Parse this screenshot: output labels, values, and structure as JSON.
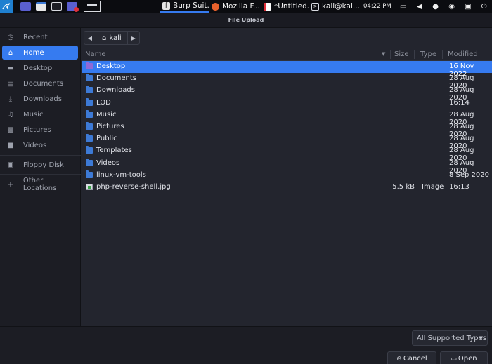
{
  "taskbar": {
    "tasks": [
      {
        "label": "Burp Suit...",
        "icon": "burp-icon"
      },
      {
        "label": "Mozilla F...",
        "icon": "firefox-icon"
      },
      {
        "label": "*Untitled...",
        "icon": "text-editor-icon"
      },
      {
        "label": "kali@kal...",
        "icon": "terminal-icon"
      }
    ],
    "clock": "04:22 PM"
  },
  "dialog": {
    "title": "File Upload"
  },
  "sidebar": {
    "items": [
      {
        "label": "Recent",
        "icon": "clock-icon"
      },
      {
        "label": "Home",
        "icon": "home-icon",
        "selected": true
      },
      {
        "label": "Desktop",
        "icon": "desktop-icon"
      },
      {
        "label": "Documents",
        "icon": "document-icon"
      },
      {
        "label": "Downloads",
        "icon": "download-icon"
      },
      {
        "label": "Music",
        "icon": "music-icon"
      },
      {
        "label": "Pictures",
        "icon": "picture-icon"
      },
      {
        "label": "Videos",
        "icon": "video-icon"
      },
      {
        "label": "Floppy Disk",
        "icon": "floppy-icon"
      },
      {
        "label": "Other Locations",
        "icon": "plus-icon"
      }
    ]
  },
  "pathbar": {
    "crumb": "kali"
  },
  "filelist": {
    "columns": {
      "name": "Name",
      "size": "Size",
      "type": "Type",
      "modified": "Modified"
    },
    "rows": [
      {
        "name": "Desktop",
        "size": "",
        "type": "",
        "modified": "16 Nov 2022",
        "selected": true,
        "kind": "folder"
      },
      {
        "name": "Documents",
        "size": "",
        "type": "",
        "modified": "28 Aug 2020",
        "kind": "folder"
      },
      {
        "name": "Downloads",
        "size": "",
        "type": "",
        "modified": "28 Aug 2020",
        "kind": "folder"
      },
      {
        "name": "LOD",
        "size": "",
        "type": "",
        "modified": "16:14",
        "kind": "folder"
      },
      {
        "name": "Music",
        "size": "",
        "type": "",
        "modified": "28 Aug 2020",
        "kind": "folder"
      },
      {
        "name": "Pictures",
        "size": "",
        "type": "",
        "modified": "28 Aug 2020",
        "kind": "folder"
      },
      {
        "name": "Public",
        "size": "",
        "type": "",
        "modified": "28 Aug 2020",
        "kind": "folder"
      },
      {
        "name": "Templates",
        "size": "",
        "type": "",
        "modified": "28 Aug 2020",
        "kind": "folder"
      },
      {
        "name": "Videos",
        "size": "",
        "type": "",
        "modified": "28 Aug 2020",
        "kind": "folder"
      },
      {
        "name": "linux-vm-tools",
        "size": "",
        "type": "",
        "modified": "8 Sep 2020",
        "kind": "folder"
      },
      {
        "name": "php-reverse-shell.jpg",
        "size": "5.5 kB",
        "type": "Image",
        "modified": "16:13",
        "kind": "image"
      }
    ]
  },
  "footer": {
    "filter": "All Supported Types",
    "cancel_label": "Cancel",
    "open_label": "Open"
  },
  "colors": {
    "accent": "#367bf0",
    "background": "#23252e",
    "sidebar": "#1c1d24"
  }
}
